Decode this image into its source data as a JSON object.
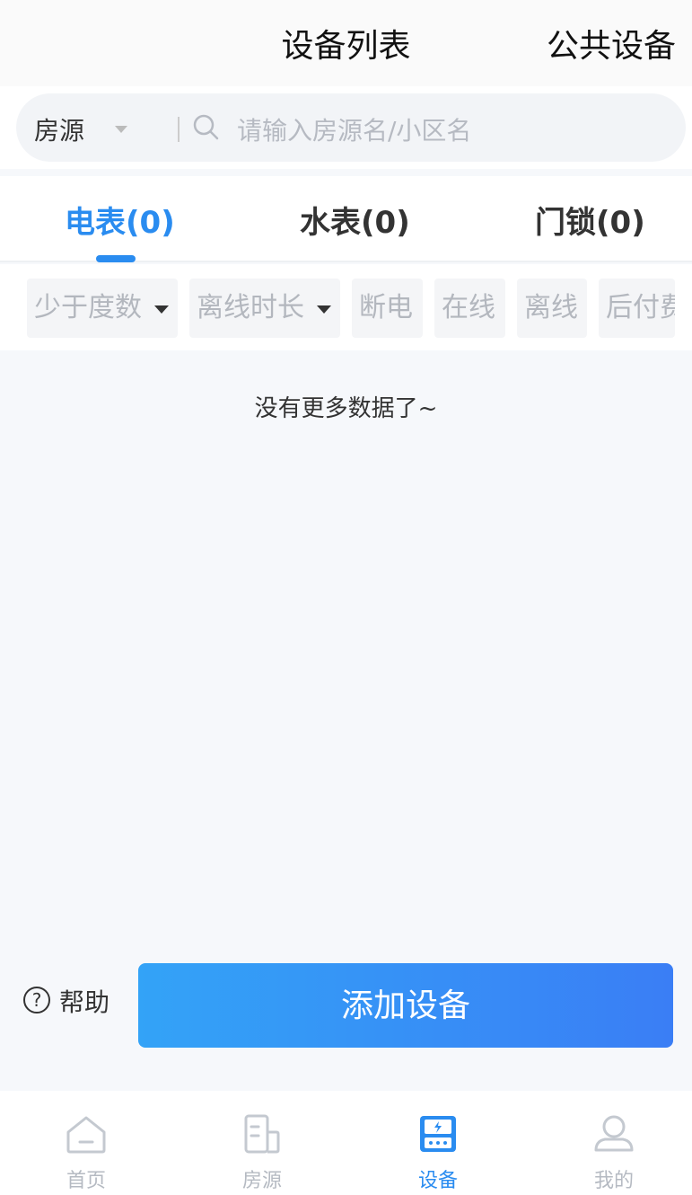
{
  "header": {
    "title": "设备列表",
    "right_action": "公共设备"
  },
  "search": {
    "selector_label": "房源",
    "placeholder": "请输入房源名/小区名"
  },
  "tabs": [
    {
      "label": "电表(0)",
      "active": true
    },
    {
      "label": "水表(0)",
      "active": false
    },
    {
      "label": "门锁(0)",
      "active": false
    }
  ],
  "filters": [
    {
      "label": "少于度数",
      "dropdown": true
    },
    {
      "label": "离线时长",
      "dropdown": true
    },
    {
      "label": "断电",
      "dropdown": false
    },
    {
      "label": "在线",
      "dropdown": false
    },
    {
      "label": "离线",
      "dropdown": false
    },
    {
      "label": "后付费",
      "dropdown": false
    }
  ],
  "empty_message": "没有更多数据了~",
  "help": {
    "icon": "question-icon",
    "label": "帮助"
  },
  "add_button": {
    "label": "添加设备"
  },
  "bottom_nav": [
    {
      "label": "首页",
      "icon": "home-icon",
      "active": false
    },
    {
      "label": "房源",
      "icon": "building-icon",
      "active": false
    },
    {
      "label": "设备",
      "icon": "device-icon",
      "active": true
    },
    {
      "label": "我的",
      "icon": "profile-icon",
      "active": false
    }
  ],
  "colors": {
    "accent": "#2a8cf0",
    "inactive_text": "#b5bac2",
    "button_gradient_start": "#33a3f7",
    "button_gradient_end": "#3a7ef5"
  }
}
